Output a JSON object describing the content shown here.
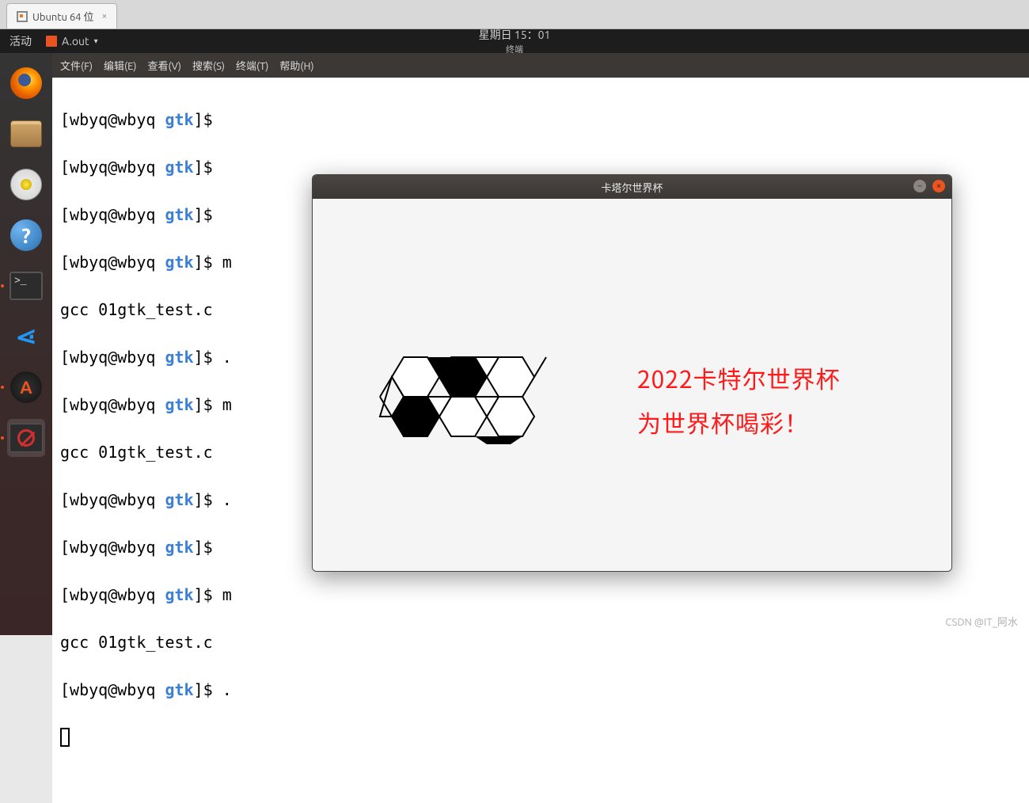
{
  "vmware": {
    "tab_label": "Ubuntu 64 位"
  },
  "panel": {
    "activities": "活动",
    "app_label": "A.out",
    "clock": "星期日 15：01",
    "subtitle": "终端"
  },
  "dock": {
    "firefox": "firefox-icon",
    "files": "files-icon",
    "rhythmbox": "rhythmbox-icon",
    "help": "help-icon",
    "terminal": "terminal-icon",
    "vscode": "vscode-icon",
    "updater": "software-updater-icon",
    "denied": "blocked-app-icon"
  },
  "menubar": {
    "file": "文件(F)",
    "edit": "编辑(E)",
    "view": "查看(V)",
    "search": "搜索(S)",
    "terminal": "终端(T)",
    "help": "帮助(H)"
  },
  "terminal_lines": {
    "l1_pre": "[wbyq@wbyq ",
    "l1_hl": "gtk",
    "l1_post": "]$ ",
    "l2_pre": "[wbyq@wbyq ",
    "l2_hl": "gtk",
    "l2_post": "]$ ",
    "l3_pre": "[wbyq@wbyq ",
    "l3_hl": "gtk",
    "l3_post": "]$ ",
    "l4_pre": "[wbyq@wbyq ",
    "l4_hl": "gtk",
    "l4_post": "]$ m",
    "l5": "gcc 01gtk_test.c",
    "l6_pre": "[wbyq@wbyq ",
    "l6_hl": "gtk",
    "l6_post": "]$ .",
    "l7_pre": "[wbyq@wbyq ",
    "l7_hl": "gtk",
    "l7_post": "]$ m",
    "l8": "gcc 01gtk_test.c",
    "l9_pre": "[wbyq@wbyq ",
    "l9_hl": "gtk",
    "l9_post": "]$ .",
    "l10_pre": "[wbyq@wbyq ",
    "l10_hl": "gtk",
    "l10_post": "]$ ",
    "l11_pre": "[wbyq@wbyq ",
    "l11_hl": "gtk",
    "l11_post": "]$ m",
    "l12": "gcc 01gtk_test.c",
    "l13_pre": "[wbyq@wbyq ",
    "l13_hl": "gtk",
    "l13_post": "]$ ."
  },
  "gtk": {
    "title": "卡塔尔世界杯",
    "line1": "2022卡特尔世界杯",
    "line2": "为世界杯喝彩！"
  },
  "watermark": "CSDN @IT_阿水",
  "help_glyph": "?",
  "term_glyph": ">_",
  "vscode_glyph": "⋖",
  "updater_glyph": "A",
  "close_glyph": "×",
  "min_glyph": "–"
}
